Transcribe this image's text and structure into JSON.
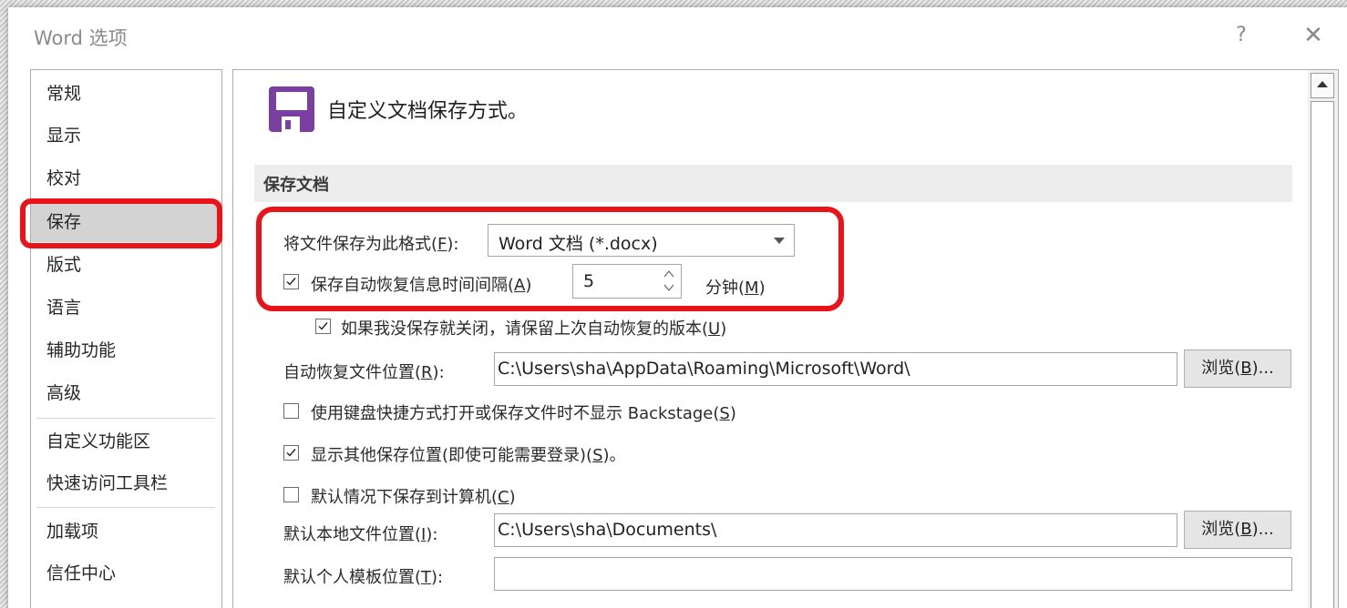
{
  "window": {
    "title": "Word 选项",
    "help_glyph": "?",
    "close_glyph": "✕"
  },
  "sidebar": {
    "items": [
      {
        "label": "常规"
      },
      {
        "label": "显示"
      },
      {
        "label": "校对"
      },
      {
        "label": "保存",
        "selected": true
      },
      {
        "label": "版式"
      },
      {
        "label": "语言"
      },
      {
        "label": "辅助功能"
      },
      {
        "label": "高级"
      },
      {
        "label": "自定义功能区"
      },
      {
        "label": "快速访问工具栏"
      },
      {
        "label": "加载项"
      },
      {
        "label": "信任中心"
      }
    ]
  },
  "main": {
    "header_icon": "save-disk-icon",
    "header_text": "自定义文档保存方式。",
    "section_title": "保存文档",
    "format_label_prefix": "将文件保存为此格式(",
    "format_label_key": "F",
    "format_label_suffix": "):",
    "format_value": "Word 文档 (*.docx)",
    "autosave_checked": true,
    "autosave_label_prefix": "保存自动恢复信息时间间隔(",
    "autosave_label_key": "A",
    "autosave_label_suffix": ")",
    "autosave_minutes": "5",
    "minutes_label_prefix": "分钟(",
    "minutes_label_key": "M",
    "minutes_label_suffix": ")",
    "keep_last_checked": true,
    "keep_last_label_prefix": "如果我没保存就关闭，请保留上次自动恢复的版本(",
    "keep_last_label_key": "U",
    "keep_last_label_suffix": ")",
    "autorecover_label_prefix": "自动恢复文件位置(",
    "autorecover_label_key": "R",
    "autorecover_label_suffix": "):",
    "autorecover_path": "C:\\Users\\sha\\AppData\\Roaming\\Microsoft\\Word\\",
    "browse_label_prefix": "浏览(",
    "browse_label_key": "B",
    "browse_label_suffix": ")...",
    "backstage_checked": false,
    "backstage_label_prefix": "使用键盘快捷方式打开或保存文件时不显示 Backstage(",
    "backstage_label_key": "S",
    "backstage_label_suffix": ")",
    "show_locations_checked": true,
    "show_locations_label_prefix": "显示其他保存位置(即使可能需要登录)(",
    "show_locations_label_key": "S",
    "show_locations_label_suffix": ")。",
    "save_to_computer_checked": false,
    "save_to_computer_label_prefix": "默认情况下保存到计算机(",
    "save_to_computer_label_key": "C",
    "save_to_computer_label_suffix": ")",
    "local_location_label_prefix": "默认本地文件位置(",
    "local_location_label_key": "I",
    "local_location_label_suffix": "):",
    "local_location_path": "C:\\Users\\sha\\Documents\\",
    "template_location_label_prefix": "默认个人模板位置(",
    "template_location_label_key": "T",
    "template_location_label_suffix": "):",
    "template_location_path": ""
  },
  "colors": {
    "highlight_annotation": "#e8141a",
    "save_icon": "#7b3fa3",
    "selected_nav_bg": "#d3d3d3"
  }
}
